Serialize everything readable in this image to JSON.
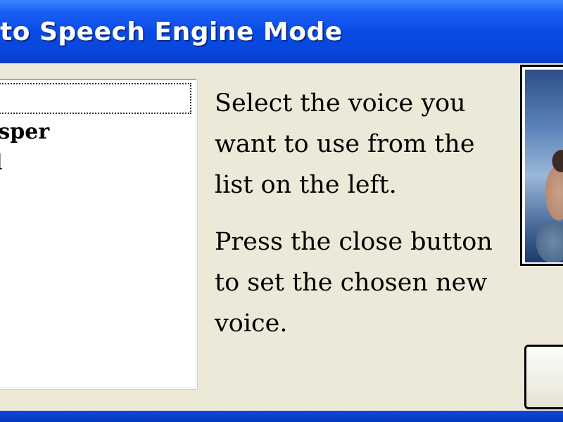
{
  "window": {
    "title": "to Speech Engine Mode"
  },
  "voice_list": {
    "items": [
      {
        "label": "",
        "focused": true
      },
      {
        "label": "isper",
        "focused": false
      },
      {
        "label": "l",
        "focused": false
      }
    ]
  },
  "instructions": {
    "paragraph1": "Select the voice you want to use from the list on the left.",
    "paragraph2": "Press the close button to set the chosen new voice."
  },
  "colors": {
    "title_bar": "#0a4be6",
    "client_bg": "#ece9d8",
    "list_bg": "#ffffff"
  }
}
